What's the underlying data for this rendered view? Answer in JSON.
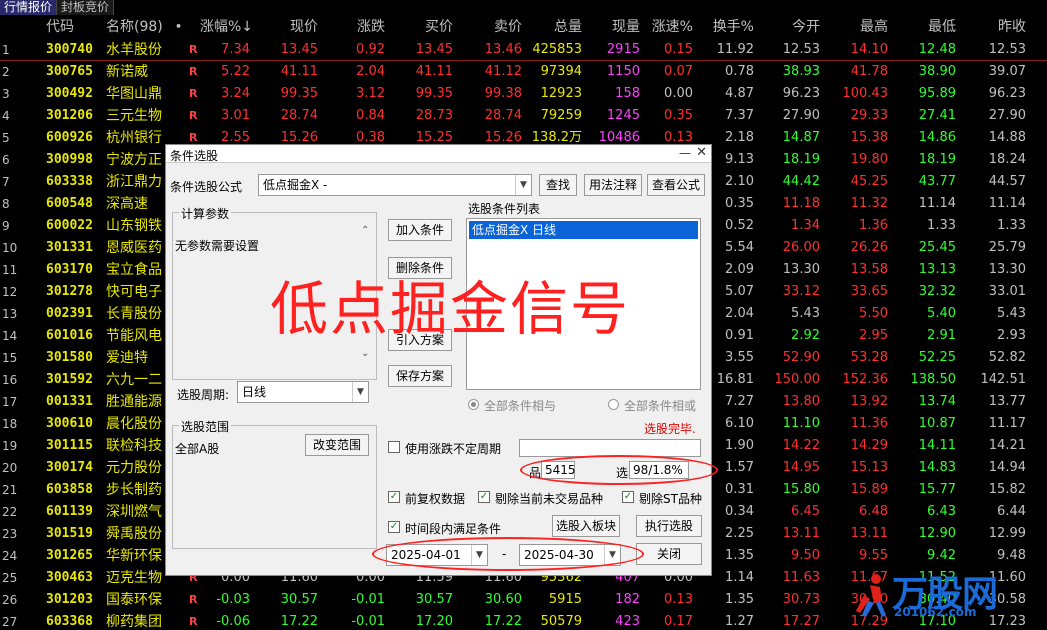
{
  "tabs": [
    {
      "label": "行情报价",
      "active": true
    },
    {
      "label": "封板竞价",
      "active": false
    }
  ],
  "table": {
    "headers": {
      "idx": "",
      "code": "代码",
      "name": "名称(98)",
      "dot": "•",
      "pct": "涨幅%↓",
      "price": "现价",
      "chg": "涨跌",
      "buy": "买价",
      "sell": "卖价",
      "vol": "总量",
      "cur": "现量",
      "spd": "涨速%",
      "turn": "换手%",
      "open": "今开",
      "high": "最高",
      "low": "最低",
      "prev": "昨收"
    },
    "rows": [
      {
        "idx": "1",
        "code": "300740",
        "name": "水羊股份",
        "flag": "R",
        "pct": "7.34",
        "price": "13.45",
        "chg": "0.92",
        "buy": "13.45",
        "sell": "13.46",
        "vol": "425853",
        "cur": "2915",
        "spd": "0.15",
        "turn": "11.92",
        "open": "12.53",
        "high": "14.10",
        "low": "12.48",
        "prev": "12.53",
        "dir": "up",
        "od": "neu",
        "hd": "up",
        "ld": "down",
        "sd": "up"
      },
      {
        "idx": "2",
        "code": "300765",
        "name": "新诺威",
        "flag": "R",
        "pct": "5.22",
        "price": "41.11",
        "chg": "2.04",
        "buy": "41.11",
        "sell": "41.12",
        "vol": "97394",
        "cur": "1150",
        "spd": "0.07",
        "turn": "0.78",
        "open": "38.93",
        "high": "41.78",
        "low": "38.90",
        "prev": "39.07",
        "dir": "up",
        "od": "down",
        "hd": "up",
        "ld": "down",
        "sd": "up"
      },
      {
        "idx": "3",
        "code": "300492",
        "name": "华图山鼎",
        "flag": "R",
        "pct": "3.24",
        "price": "99.35",
        "chg": "3.12",
        "buy": "99.35",
        "sell": "99.38",
        "vol": "12923",
        "cur": "158",
        "spd": "0.00",
        "turn": "4.87",
        "open": "96.23",
        "high": "100.43",
        "low": "95.89",
        "prev": "96.23",
        "dir": "up",
        "od": "neu",
        "hd": "up",
        "ld": "down",
        "sd": "neu"
      },
      {
        "idx": "4",
        "code": "301206",
        "name": "三元生物",
        "flag": "R",
        "pct": "3.01",
        "price": "28.74",
        "chg": "0.84",
        "buy": "28.73",
        "sell": "28.74",
        "vol": "79259",
        "cur": "1245",
        "spd": "0.35",
        "turn": "7.37",
        "open": "27.90",
        "high": "29.33",
        "low": "27.41",
        "prev": "27.90",
        "dir": "up",
        "od": "neu",
        "hd": "up",
        "ld": "down",
        "sd": "up"
      },
      {
        "idx": "5",
        "code": "600926",
        "name": "杭州银行",
        "flag": "R",
        "pct": "2.55",
        "price": "15.26",
        "chg": "0.38",
        "buy": "15.25",
        "sell": "15.26",
        "vol": "138.2万",
        "cur": "10486",
        "spd": "0.13",
        "turn": "2.18",
        "open": "14.87",
        "high": "15.38",
        "low": "14.86",
        "prev": "14.88",
        "dir": "up",
        "od": "down",
        "hd": "up",
        "ld": "down",
        "sd": "up"
      },
      {
        "idx": "6",
        "code": "300998",
        "name": "宁波方正",
        "flag": "",
        "pct": "",
        "price": "",
        "chg": "",
        "buy": "",
        "sell": "",
        "vol": "",
        "cur": "",
        "spd": "",
        "turn": "9.13",
        "open": "18.19",
        "high": "19.80",
        "low": "18.19",
        "prev": "18.24",
        "dir": "up",
        "od": "down",
        "hd": "up",
        "ld": "down",
        "sd": "up"
      },
      {
        "idx": "7",
        "code": "603338",
        "name": "浙江鼎力",
        "flag": "",
        "pct": "",
        "price": "",
        "chg": "",
        "buy": "",
        "sell": "",
        "vol": "",
        "cur": "",
        "spd": "",
        "turn": "2.10",
        "open": "44.42",
        "high": "45.25",
        "low": "43.77",
        "prev": "44.57",
        "dir": "up",
        "od": "down",
        "hd": "up",
        "ld": "down",
        "sd": "up"
      },
      {
        "idx": "8",
        "code": "600548",
        "name": "深高速",
        "flag": "",
        "pct": "",
        "price": "",
        "chg": "",
        "buy": "",
        "sell": "",
        "vol": "",
        "cur": "",
        "spd": "",
        "turn": "0.35",
        "open": "11.18",
        "high": "11.32",
        "low": "11.14",
        "prev": "11.14",
        "dir": "up",
        "od": "up",
        "hd": "up",
        "ld": "neu",
        "sd": "up"
      },
      {
        "idx": "9",
        "code": "600022",
        "name": "山东钢铁",
        "flag": "",
        "pct": "",
        "price": "",
        "chg": "",
        "buy": "",
        "sell": "",
        "vol": "",
        "cur": "",
        "spd": "",
        "turn": "0.52",
        "open": "1.34",
        "high": "1.36",
        "low": "1.33",
        "prev": "1.33",
        "dir": "up",
        "od": "up",
        "hd": "up",
        "ld": "neu",
        "sd": "up"
      },
      {
        "idx": "10",
        "code": "301331",
        "name": "恩威医药",
        "flag": "",
        "pct": "",
        "price": "",
        "chg": "",
        "buy": "",
        "sell": "",
        "vol": "",
        "cur": "",
        "spd": "",
        "turn": "5.54",
        "open": "26.00",
        "high": "26.26",
        "low": "25.45",
        "prev": "25.79",
        "dir": "up",
        "od": "up",
        "hd": "up",
        "ld": "down",
        "sd": "up"
      },
      {
        "idx": "11",
        "code": "603170",
        "name": "宝立食品",
        "flag": "",
        "pct": "",
        "price": "",
        "chg": "",
        "buy": "",
        "sell": "",
        "vol": "",
        "cur": "",
        "spd": "",
        "turn": "2.09",
        "open": "13.30",
        "high": "13.58",
        "low": "13.13",
        "prev": "13.30",
        "dir": "up",
        "od": "neu",
        "hd": "up",
        "ld": "down",
        "sd": "up"
      },
      {
        "idx": "12",
        "code": "301278",
        "name": "快可电子",
        "flag": "",
        "pct": "",
        "price": "",
        "chg": "",
        "buy": "",
        "sell": "",
        "vol": "",
        "cur": "",
        "spd": "",
        "turn": "5.07",
        "open": "33.12",
        "high": "33.65",
        "low": "32.32",
        "prev": "33.01",
        "dir": "up",
        "od": "up",
        "hd": "up",
        "ld": "down",
        "sd": "up"
      },
      {
        "idx": "13",
        "code": "002391",
        "name": "长青股份",
        "flag": "",
        "pct": "",
        "price": "",
        "chg": "",
        "buy": "",
        "sell": "",
        "vol": "",
        "cur": "",
        "spd": "",
        "turn": "2.04",
        "open": "5.43",
        "high": "5.50",
        "low": "5.40",
        "prev": "5.43",
        "dir": "up",
        "od": "neu",
        "hd": "up",
        "ld": "down",
        "sd": "up"
      },
      {
        "idx": "14",
        "code": "601016",
        "name": "节能风电",
        "flag": "",
        "pct": "",
        "price": "",
        "chg": "",
        "buy": "",
        "sell": "",
        "vol": "",
        "cur": "",
        "spd": "",
        "turn": "0.91",
        "open": "2.92",
        "high": "2.95",
        "low": "2.91",
        "prev": "2.93",
        "dir": "up",
        "od": "down",
        "hd": "up",
        "ld": "down",
        "sd": "up"
      },
      {
        "idx": "15",
        "code": "301580",
        "name": "爱迪特",
        "flag": "",
        "pct": "",
        "price": "",
        "chg": "",
        "buy": "",
        "sell": "",
        "vol": "",
        "cur": "",
        "spd": "",
        "turn": "3.55",
        "open": "52.90",
        "high": "53.28",
        "low": "52.25",
        "prev": "52.82",
        "dir": "up",
        "od": "up",
        "hd": "up",
        "ld": "down",
        "sd": "up"
      },
      {
        "idx": "16",
        "code": "301592",
        "name": "六九一二",
        "flag": "",
        "pct": "",
        "price": "",
        "chg": "",
        "buy": "",
        "sell": "",
        "vol": "",
        "cur": "",
        "spd": "",
        "turn": "16.81",
        "open": "150.00",
        "high": "152.36",
        "low": "138.50",
        "prev": "142.51",
        "dir": "up",
        "od": "up",
        "hd": "up",
        "ld": "down",
        "sd": "up"
      },
      {
        "idx": "17",
        "code": "001331",
        "name": "胜通能源",
        "flag": "",
        "pct": "",
        "price": "",
        "chg": "",
        "buy": "",
        "sell": "",
        "vol": "",
        "cur": "",
        "spd": "",
        "turn": "7.27",
        "open": "13.80",
        "high": "13.92",
        "low": "13.74",
        "prev": "13.77",
        "dir": "up",
        "od": "up",
        "hd": "up",
        "ld": "down",
        "sd": "up"
      },
      {
        "idx": "18",
        "code": "300610",
        "name": "晨化股份",
        "flag": "",
        "pct": "",
        "price": "",
        "chg": "",
        "buy": "",
        "sell": "",
        "vol": "",
        "cur": "",
        "spd": "",
        "turn": "6.10",
        "open": "11.10",
        "high": "11.36",
        "low": "10.87",
        "prev": "11.17",
        "dir": "up",
        "od": "down",
        "hd": "up",
        "ld": "down",
        "sd": "up"
      },
      {
        "idx": "19",
        "code": "301115",
        "name": "联检科技",
        "flag": "",
        "pct": "",
        "price": "",
        "chg": "",
        "buy": "",
        "sell": "",
        "vol": "",
        "cur": "",
        "spd": "",
        "turn": "1.90",
        "open": "14.22",
        "high": "14.29",
        "low": "14.11",
        "prev": "14.21",
        "dir": "up",
        "od": "up",
        "hd": "up",
        "ld": "down",
        "sd": "up"
      },
      {
        "idx": "20",
        "code": "300174",
        "name": "元力股份",
        "flag": "",
        "pct": "",
        "price": "",
        "chg": "",
        "buy": "",
        "sell": "",
        "vol": "",
        "cur": "",
        "spd": "",
        "turn": "1.57",
        "open": "14.95",
        "high": "15.13",
        "low": "14.83",
        "prev": "14.94",
        "dir": "up",
        "od": "up",
        "hd": "up",
        "ld": "down",
        "sd": "up"
      },
      {
        "idx": "21",
        "code": "603858",
        "name": "步长制药",
        "flag": "",
        "pct": "",
        "price": "",
        "chg": "",
        "buy": "",
        "sell": "",
        "vol": "",
        "cur": "",
        "spd": "",
        "turn": "0.31",
        "open": "15.80",
        "high": "15.89",
        "low": "15.77",
        "prev": "15.82",
        "dir": "up",
        "od": "down",
        "hd": "up",
        "ld": "down",
        "sd": "up"
      },
      {
        "idx": "22",
        "code": "601139",
        "name": "深圳燃气",
        "flag": "",
        "pct": "",
        "price": "",
        "chg": "",
        "buy": "",
        "sell": "",
        "vol": "",
        "cur": "",
        "spd": "",
        "turn": "0.34",
        "open": "6.45",
        "high": "6.48",
        "low": "6.43",
        "prev": "6.44",
        "dir": "up",
        "od": "up",
        "hd": "up",
        "ld": "down",
        "sd": "up"
      },
      {
        "idx": "23",
        "code": "301519",
        "name": "舜禹股份",
        "flag": "",
        "pct": "",
        "price": "",
        "chg": "",
        "buy": "",
        "sell": "",
        "vol": "",
        "cur": "",
        "spd": "",
        "turn": "2.25",
        "open": "13.11",
        "high": "13.11",
        "low": "12.90",
        "prev": "12.99",
        "dir": "up",
        "od": "up",
        "hd": "up",
        "ld": "down",
        "sd": "up"
      },
      {
        "idx": "24",
        "code": "301265",
        "name": "华新环保",
        "flag": "",
        "pct": "",
        "price": "",
        "chg": "",
        "buy": "",
        "sell": "",
        "vol": "",
        "cur": "",
        "spd": "",
        "turn": "1.35",
        "open": "9.50",
        "high": "9.55",
        "low": "9.42",
        "prev": "9.48",
        "dir": "up",
        "od": "up",
        "hd": "up",
        "ld": "down",
        "sd": "up"
      },
      {
        "idx": "25",
        "code": "300463",
        "name": "迈克生物",
        "flag": "R",
        "pct": "0.00",
        "price": "11.60",
        "chg": "0.00",
        "buy": "11.59",
        "sell": "11.60",
        "vol": "95362",
        "cur": "407",
        "spd": "0.00",
        "turn": "1.14",
        "open": "11.63",
        "high": "11.67",
        "low": "11.52",
        "prev": "11.60",
        "dir": "neu",
        "od": "up",
        "hd": "up",
        "ld": "down",
        "sd": "neu"
      },
      {
        "idx": "26",
        "code": "301203",
        "name": "国泰环保",
        "flag": "R",
        "pct": "-0.03",
        "price": "30.57",
        "chg": "-0.01",
        "buy": "30.57",
        "sell": "30.60",
        "vol": "5915",
        "cur": "182",
        "spd": "0.13",
        "turn": "1.35",
        "open": "30.73",
        "high": "30.90",
        "low": "30.40",
        "prev": "30.58",
        "dir": "down",
        "od": "up",
        "hd": "up",
        "ld": "down",
        "sd": "up"
      },
      {
        "idx": "27",
        "code": "603368",
        "name": "柳药集团",
        "flag": "R",
        "pct": "-0.06",
        "price": "17.22",
        "chg": "-0.01",
        "buy": "17.20",
        "sell": "17.22",
        "vol": "50579",
        "cur": "423",
        "spd": "0.17",
        "turn": "1.27",
        "open": "17.27",
        "high": "17.29",
        "low": "17.10",
        "prev": "17.23",
        "dir": "down",
        "od": "up",
        "hd": "up",
        "ld": "down",
        "sd": "up"
      }
    ]
  },
  "dialog": {
    "title": "条件选股",
    "formula_label": "条件选股公式",
    "formula_value": "低点掘金X  -",
    "btn_find": "查找",
    "btn_usage": "用法注释",
    "btn_view": "查看公式",
    "params_title": "计算参数",
    "params_text": "无参数需要设置",
    "period_label": "选股周期:",
    "period_value": "日线",
    "btn_add": "加入条件",
    "btn_delete": "删除条件",
    "btn_import": "引入方案",
    "btn_save": "保存方案",
    "list_title": "选股条件列表",
    "list_item": "低点掘金X  日线",
    "radio_and": "全部条件相与",
    "radio_or": "全部条件相或",
    "status": "选股完毕.",
    "scope_title": "选股范围",
    "scope_value": "全部A股",
    "btn_scope": "改变范围",
    "chk_uncertain": "使用涨跌不定周期",
    "count_label": "品种数",
    "count_value": "5415",
    "selected_label": "选中数",
    "selected_value": "98/1.8%",
    "chk_adjust": "前复权数据",
    "chk_exclude_untraded": "剔除当前未交易品种",
    "chk_exclude_st": "剔除ST品种",
    "chk_period": "时间段内满足条件",
    "btn_to_block": "选股入板块",
    "btn_run": "执行选股",
    "date_from": "2025-04-01",
    "date_sep": "-",
    "date_to": "2025-04-30",
    "btn_close": "关闭"
  },
  "overlay": {
    "headline": "低点掘金信号"
  },
  "watermark": {
    "brand": "万股网",
    "url": "201062.com"
  },
  "colors": {
    "up": "#ff3030",
    "down": "#30ff30",
    "code": "#e8e800",
    "accent": "#0a64d8",
    "headline": "#ff2020"
  }
}
